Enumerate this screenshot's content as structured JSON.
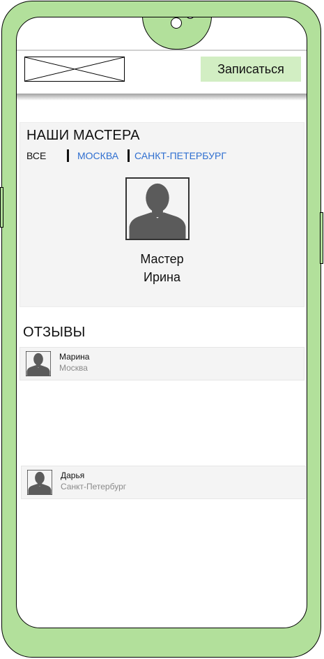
{
  "header": {
    "signup_label": "Записаться"
  },
  "masters": {
    "title": "НАШИ МАСТЕРА",
    "filters": [
      "ВСЕ",
      "МОСКВА",
      "САНКТ-ПЕТЕРБУРГ"
    ],
    "master": {
      "first_line": "Мастер",
      "second_line": "Ирина"
    }
  },
  "reviews": {
    "title": "ОТЗЫВЫ",
    "items": [
      {
        "name": "Марина",
        "city": "Москва"
      },
      {
        "name": "Дарья",
        "city": "Санкт-Петербург"
      }
    ]
  },
  "colors": {
    "phone": "#b2e09b",
    "button": "#d2eec3",
    "link": "#2f6fd0",
    "panel": "#f4f4f4",
    "avatar": "#5b5b5b"
  },
  "icons": [
    "logo-placeholder",
    "user-silhouette-icon"
  ]
}
